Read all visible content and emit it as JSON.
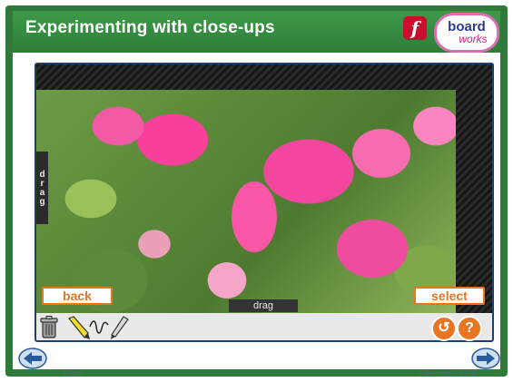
{
  "header": {
    "title": "Experimenting with close-ups",
    "flash_icon_glyph": "f",
    "logo_line1": "board",
    "logo_line2": "works"
  },
  "activity": {
    "drag_handle_left": "drag",
    "drag_handle_bottom": "drag",
    "back_label": "back",
    "select_label": "select"
  },
  "toolbar": {
    "tools": [
      "trash-icon",
      "pencil-icon",
      "squiggle-icon",
      "pen-icon"
    ],
    "reset_glyph": "↺",
    "help_glyph": "?"
  },
  "footer": {
    "slide_number": "15 of 17",
    "copyright": "© Boardworks Ltd 2009"
  },
  "colors": {
    "frame_green": "#2f7a3a",
    "accent_orange": "#e87522",
    "nav_blue": "#2a5a9a"
  }
}
